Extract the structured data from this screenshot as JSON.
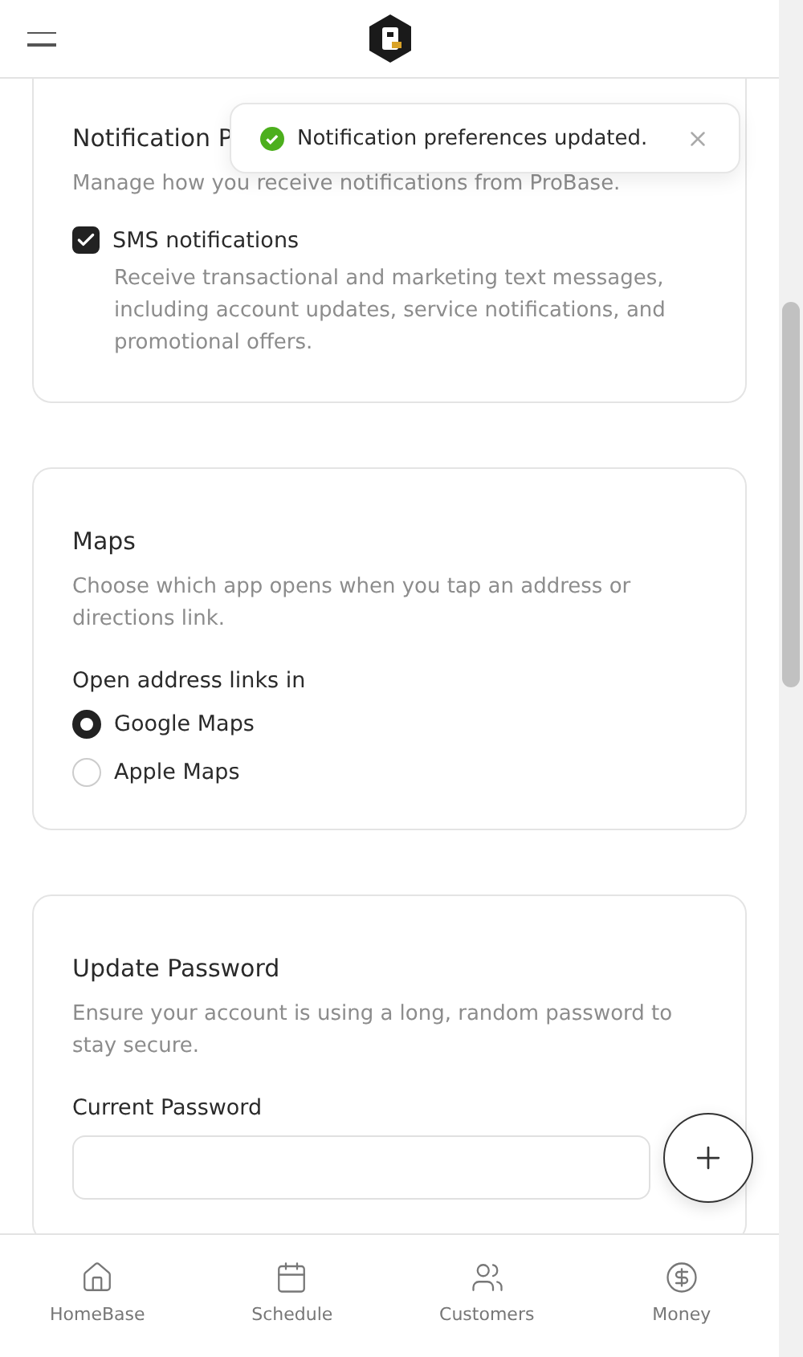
{
  "toast": {
    "message": "Notification preferences updated."
  },
  "notifications": {
    "title": "Notification P",
    "description": "Manage how you receive notifications from ProBase.",
    "options": [
      {
        "label": "SMS notifications",
        "checked": true,
        "description": "Receive transactional and marketing text messages, including account updates, service notifications, and promotional offers."
      }
    ]
  },
  "maps": {
    "title": "Maps",
    "description": "Choose which app opens when you tap an address or directions link.",
    "group_label": "Open address links in",
    "options": [
      {
        "label": "Google Maps",
        "selected": true
      },
      {
        "label": "Apple Maps",
        "selected": false
      }
    ]
  },
  "password": {
    "title": "Update Password",
    "description": "Ensure your account is using a long, random password to stay secure.",
    "field_label": "Current Password"
  },
  "bottom_nav": [
    {
      "label": "HomeBase",
      "kind": "home"
    },
    {
      "label": "Schedule",
      "kind": "calendar"
    },
    {
      "label": "Customers",
      "kind": "people"
    },
    {
      "label": "Money",
      "kind": "dollar"
    }
  ]
}
